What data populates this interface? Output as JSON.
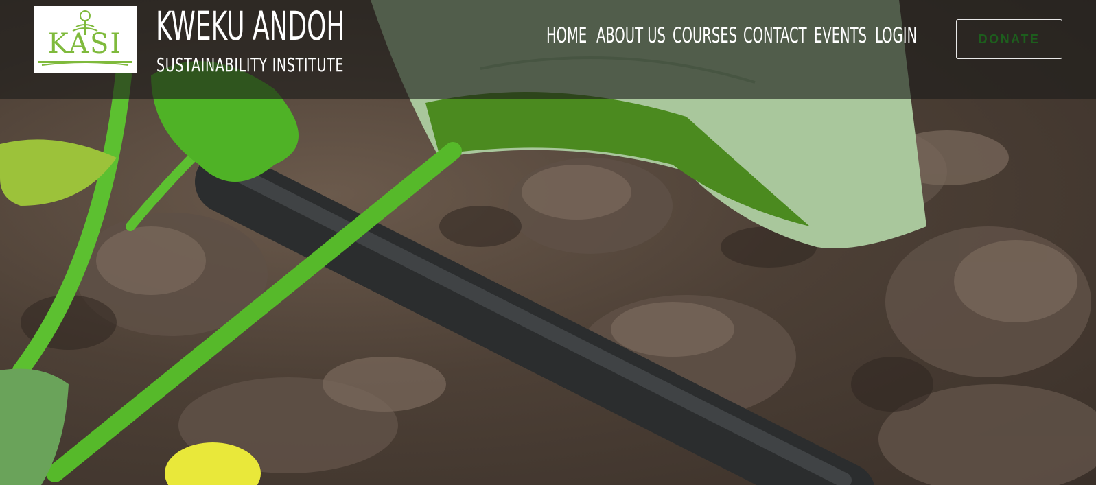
{
  "brand": {
    "logo_text": "KASI",
    "title": "KWEKU ANDOH",
    "subtitle": "SUSTAINABILITY INSTITUTE"
  },
  "nav": {
    "items": [
      {
        "label": "HOME"
      },
      {
        "label": "ABOUT US"
      },
      {
        "label": "COURSES"
      },
      {
        "label": "CONTACT"
      },
      {
        "label": "EVENTS"
      },
      {
        "label": "LOGIN"
      }
    ]
  },
  "donate": {
    "label": "DONATE"
  },
  "colors": {
    "logo_green": "#7fba3c",
    "donate_text": "#1d5e1d",
    "header_overlay": "rgba(28,28,26,0.62)"
  },
  "hero": {
    "image": "garden-drip-irrigation-photo"
  }
}
